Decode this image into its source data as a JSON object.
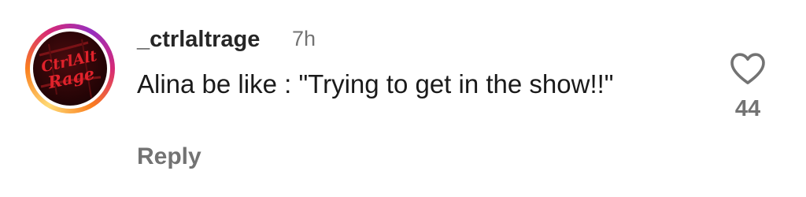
{
  "comment": {
    "username": "_ctrlaltrage",
    "time_ago": "7h",
    "text": "Alina be like : \"Trying to get in the show!!\"",
    "reply_label": "Reply",
    "like_count": "44"
  },
  "avatar": {
    "logo_text_line1": "CtrlAlt",
    "logo_text_line2": "Rage"
  },
  "colors": {
    "username": "#262626",
    "secondary_text": "#737373",
    "body_text": "#1a1a1a",
    "avatar_ring": [
      "#feda75",
      "#fa7e1e",
      "#d62976",
      "#962fbf"
    ],
    "logo_red": "#e0222b"
  },
  "icons": {
    "like": "heart-outline-icon"
  }
}
